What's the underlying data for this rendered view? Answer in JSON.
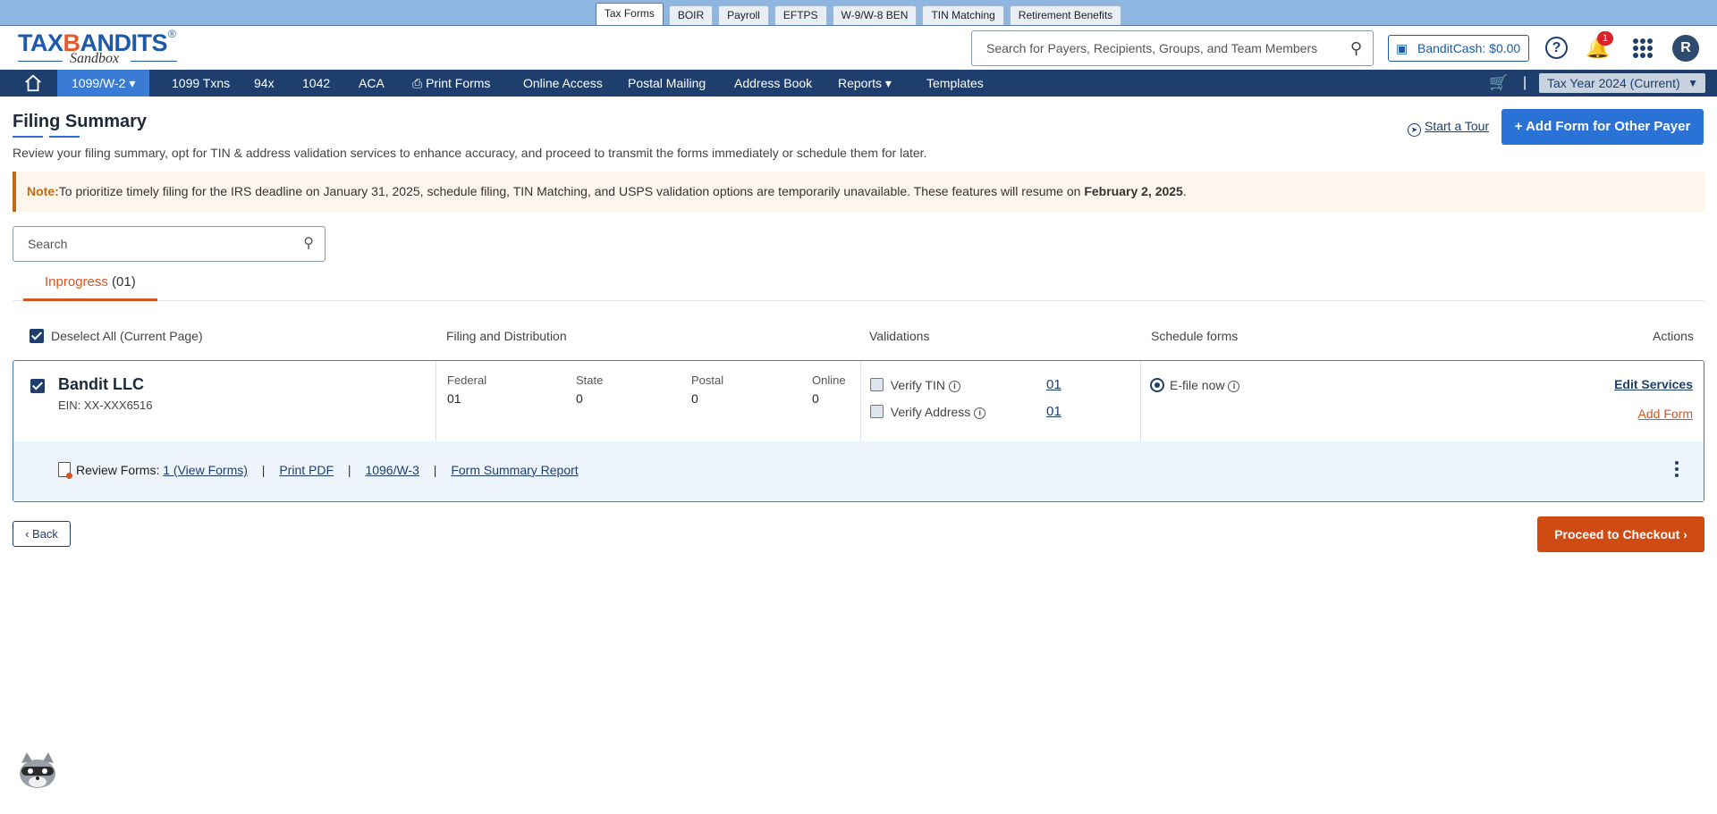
{
  "top_tabs": [
    "Tax Forms",
    "BOIR",
    "Payroll",
    "EFTPS",
    "W-9/W-8 BEN",
    "TIN Matching",
    "Retirement Benefits"
  ],
  "header": {
    "logo_text_1": "TAX",
    "logo_text_2": "ANDITS",
    "logo_reg": "®",
    "logo_sub": "Sandbox",
    "search_placeholder": "Search for Payers, Recipients, Groups, and Team Members",
    "bandit_cash": "BanditCash: $0.00",
    "notification_count": "1",
    "avatar_initial": "R"
  },
  "nav": {
    "items": [
      "1099/W-2",
      "1099 Txns",
      "94x",
      "1042",
      "ACA",
      "Print Forms",
      "Online Access",
      "Postal Mailing",
      "Address Book",
      "Reports",
      "Templates"
    ],
    "tax_year": "Tax Year 2024 (Current)",
    "separator": "|"
  },
  "page": {
    "title": "Filing Summary",
    "subtitle": "Review your filing summary, opt for TIN & address validation services to enhance accuracy, and proceed to transmit the forms immediately or schedule them for later.",
    "start_tour": "Start a Tour",
    "add_form_button": "Add Form for Other Payer",
    "note_label": "Note:",
    "note_text": "To prioritize timely filing for the IRS deadline on January 31, 2025, schedule filing, TIN Matching, and USPS validation options are temporarily unavailable. These features will resume on ",
    "note_date": "February 2, 2025",
    "note_end": ".",
    "search_placeholder": "Search",
    "tab_label": "Inprogress",
    "tab_count": "(01)"
  },
  "columns": {
    "select": "Deselect All (Current Page)",
    "filing": "Filing and Distribution",
    "validations": "Validations",
    "schedule": "Schedule forms",
    "actions": "Actions"
  },
  "payer": {
    "name": "Bandit LLC",
    "ein": "EIN: XX-XXX6516",
    "distribution": [
      {
        "label": "Federal",
        "value": "01"
      },
      {
        "label": "State",
        "value": "0"
      },
      {
        "label": "Postal",
        "value": "0"
      },
      {
        "label": "Online",
        "value": "0"
      }
    ],
    "verify_tin": "Verify TIN",
    "verify_tin_count": "01",
    "verify_address": "Verify Address",
    "verify_address_count": "01",
    "schedule_option": "E-file now",
    "edit_services": "Edit Services",
    "add_form": "Add Form",
    "review_label": "Review Forms:",
    "review_links": [
      "1 (View Forms)",
      "Print PDF",
      "1096/W-3",
      "Form Summary Report"
    ],
    "pipe": "|"
  },
  "footer": {
    "back": "Back",
    "checkout": "Proceed to Checkout"
  }
}
